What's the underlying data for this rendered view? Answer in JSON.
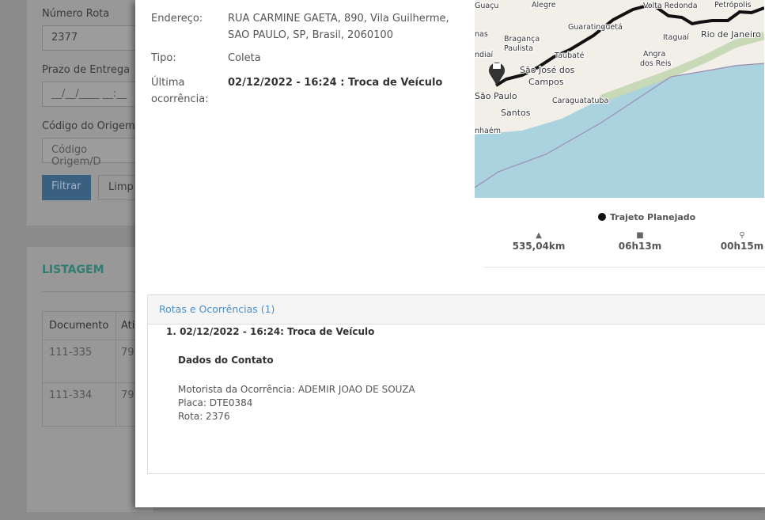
{
  "background": {
    "filters": {
      "numero_rota_label": "Número Rota",
      "numero_rota_value": "2377",
      "prazo_label": "Prazo de Entrega",
      "prazo_placeholder": "__/__/____ __:__",
      "codigo_label": "Código do Origem/",
      "codigo_placeholder": "Código Origem/D",
      "filtrar": "Filtrar",
      "limpar": "Limp"
    },
    "listagem": {
      "title": "LISTAGEM",
      "headers": [
        "Documento",
        "Ati"
      ],
      "rows": [
        [
          "111-335",
          "79"
        ],
        [
          "111-334",
          "79"
        ]
      ]
    }
  },
  "modal": {
    "endereco_label": "Endereço:",
    "endereco_value": "RUA CARMINE GAETA, 890, Vila Guilherme, SAO PAULO, SP, Brasil, 2060100",
    "tipo_label": "Tipo:",
    "tipo_value": "Coleta",
    "ultima_label": "Última ocorrência:",
    "ultima_value": "02/12/2022 - 16:24 : Troca de Veículo",
    "map": {
      "cities": [
        "Guaçu",
        "Alegre",
        "Volta Redonda",
        "Petrópolis",
        "nas",
        "Bragança",
        "Paulista",
        "Guaratinguetá",
        "Itaguaí",
        "Rio de Janeiro",
        "ndiaí",
        "Taubaté",
        "São José dos",
        "Campos",
        "Angra",
        "dos Reis",
        "São Paulo",
        "Caraguatatuba",
        "Santos",
        "nhaém"
      ],
      "route_color": "#111111",
      "sea_color": "#aad3df",
      "land_color": "#f2efe9"
    },
    "legend": "Trajeto Planejado",
    "stats": [
      {
        "icon": "road-icon",
        "value": "535,04km"
      },
      {
        "icon": "truck-icon",
        "value": "06h13m"
      },
      {
        "icon": "map-pin-icon",
        "value": "00h15m"
      }
    ],
    "panel": {
      "title": "Rotas e Ocorrências (1)",
      "item": "1. 02/12/2022 - 16:24: Troca de Veículo",
      "contact_title": "Dados do Contato",
      "motorista": "Motorista da Ocorrência: ADEMIR JOAO DE SOUZA",
      "placa": "Placa: DTE0384",
      "rota": "Rota: 2376"
    }
  }
}
